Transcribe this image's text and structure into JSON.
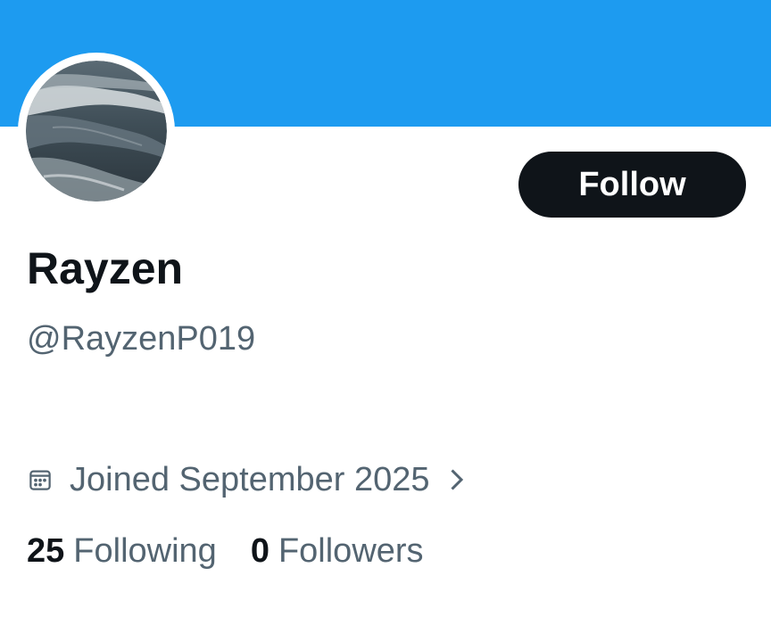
{
  "profile": {
    "display_name": "Rayzen",
    "handle": "@RayzenP019",
    "joined": "Joined September 2025"
  },
  "actions": {
    "follow_label": "Follow"
  },
  "stats": {
    "following_count": "25",
    "following_label": "Following",
    "followers_count": "0",
    "followers_label": "Followers"
  },
  "icons": {
    "calendar": "calendar-icon",
    "chevron": "chevron-right-icon"
  },
  "colors": {
    "banner": "#1d9bf0",
    "primary_text": "#0f1419",
    "secondary_text": "#536471",
    "button_bg": "#0f1419",
    "button_text": "#ffffff"
  }
}
